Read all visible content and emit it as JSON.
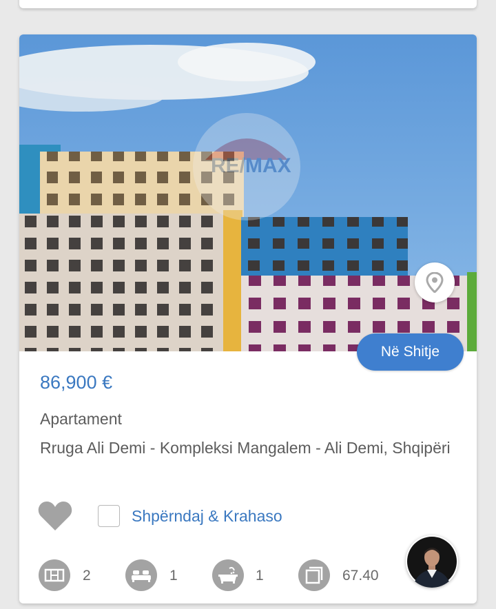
{
  "listing": {
    "status_badge": "Në Shitje",
    "price": "86,900 €",
    "property_type": "Apartament",
    "address": "Rruga Ali Demi - Kompleksi Mangalem - Ali Demi, Shqipëri",
    "watermark": "RE/MAX",
    "share_compare_label": "Shpërndaj & Krahaso",
    "features": {
      "rooms": "2",
      "bedrooms": "1",
      "bathrooms": "1",
      "area": "67.40"
    }
  },
  "icons": [
    "map-pin-icon",
    "heart-icon",
    "rooms-icon",
    "bed-icon",
    "bathtub-icon",
    "area-icon"
  ],
  "colors": {
    "accent": "#3a78c0",
    "badge": "#3f7fcf",
    "icon_gray": "#a3a3a3",
    "background": "#e9e9e9"
  }
}
